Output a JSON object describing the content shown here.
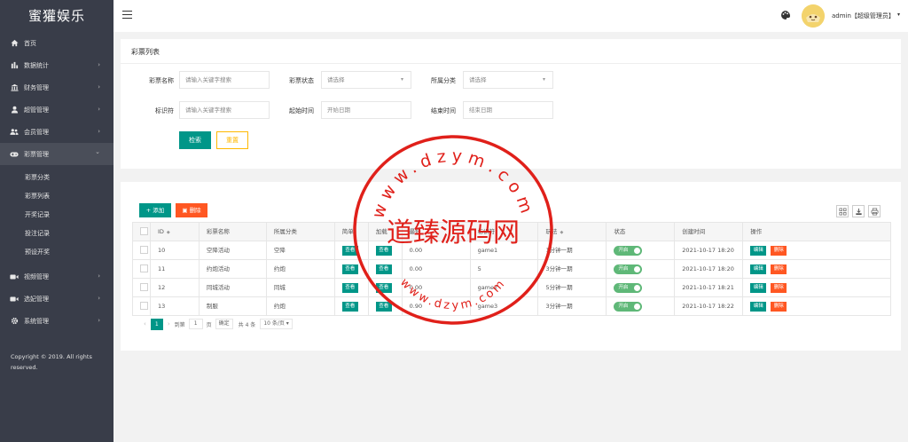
{
  "sidebar": {
    "logo": "蜜獾娱乐",
    "items": [
      {
        "label": "首页",
        "icon": "home-icon",
        "arrow": ""
      },
      {
        "label": "数据统计",
        "icon": "bar-chart-icon",
        "arrow": "›"
      },
      {
        "label": "财务管理",
        "icon": "bank-icon",
        "arrow": "›"
      },
      {
        "label": "超管管理",
        "icon": "user-icon",
        "arrow": "›"
      },
      {
        "label": "会员管理",
        "icon": "users-icon",
        "arrow": "›"
      },
      {
        "label": "彩票管理",
        "icon": "gamepad-icon",
        "arrow": "⌄"
      }
    ],
    "sub_items": [
      "彩票分类",
      "彩票列表",
      "开奖记录",
      "投注记录",
      "预设开奖"
    ],
    "items_after": [
      {
        "label": "视频管理",
        "icon": "video-icon",
        "arrow": "›"
      },
      {
        "label": "选妃管理",
        "icon": "video-icon",
        "arrow": "›"
      },
      {
        "label": "系统管理",
        "icon": "gear-icon",
        "arrow": "›"
      }
    ],
    "copyright": "Copyright © 2019. All rights reserved."
  },
  "header": {
    "user": "admin【超级管理员】",
    "caret": "▾"
  },
  "filter": {
    "title": "彩票列表",
    "name_label": "彩票名称",
    "name_placeholder": "请输入关键字搜索",
    "status_label": "彩票状态",
    "status_placeholder": "请选择",
    "category_label": "所属分类",
    "category_placeholder": "请选择",
    "tag_label": "标识符",
    "tag_placeholder": "请输入关键字搜索",
    "start_label": "起始时间",
    "start_placeholder": "开始日期",
    "end_label": "结束时间",
    "end_placeholder": "结束日期",
    "search_button": "检索",
    "reset_button": "重置"
  },
  "toolbar": {
    "add_button": "+ 添加",
    "delete_button": "▣ 删除"
  },
  "table": {
    "headers": [
      "",
      "ID",
      "彩票名称",
      "所属分类",
      "简单",
      "加载",
      "最低",
      "标识符",
      "玩法",
      "状态",
      "创建时间",
      "操作"
    ],
    "view_label": "查看",
    "switch_label": "开启",
    "edit_label": "编辑",
    "remove_label": "删除",
    "rows": [
      {
        "id": "10",
        "name": "空降活动",
        "category": "空降",
        "min": "0.00",
        "tag": "game1",
        "play": "1分钟一期",
        "created": "2021-10-17 18:20"
      },
      {
        "id": "11",
        "name": "约炮活动",
        "category": "约炮",
        "min": "0.00",
        "tag": "5",
        "play": "3分钟一期",
        "created": "2021-10-17 18:20"
      },
      {
        "id": "12",
        "name": "同城活动",
        "category": "同城",
        "min": "0.00",
        "tag": "game2",
        "play": "5分钟一期",
        "created": "2021-10-17 18:21"
      },
      {
        "id": "13",
        "name": "制服",
        "category": "约炮",
        "min": "0.90",
        "tag": "game3",
        "play": "3分钟一期",
        "created": "2021-10-17 18:22"
      }
    ]
  },
  "pager": {
    "prev": "‹",
    "current": "1",
    "next": "›",
    "goto_label": "到第",
    "goto_value": "1",
    "page_label": "页",
    "confirm": "确定",
    "total": "共 4 条",
    "page_size": "10 条/页 ▾"
  },
  "watermark": {
    "top_text": "www.dzym.com",
    "middle_text": "道臻源码网",
    "bottom_text": "www.dzym.com",
    "color": "#e0201a"
  }
}
